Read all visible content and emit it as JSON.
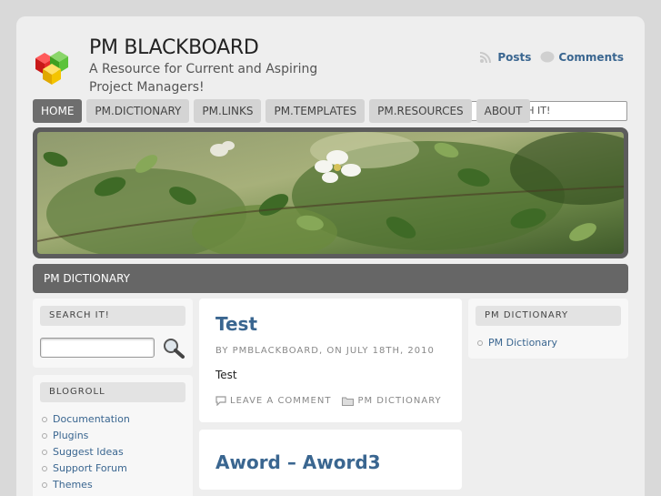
{
  "site": {
    "title": "PM BLACKBOARD",
    "description": "A Resource for Current and Aspiring Project Managers!"
  },
  "feeds": {
    "posts_label": "Posts",
    "comments_label": "Comments"
  },
  "nav": {
    "items": [
      {
        "label": "HOME"
      },
      {
        "label": "PM.DICTIONARY"
      },
      {
        "label": "PM.LINKS"
      },
      {
        "label": "PM.TEMPLATES"
      },
      {
        "label": "PM.RESOURCES"
      },
      {
        "label": "ABOUT"
      }
    ],
    "search_value": "SEARCH IT!"
  },
  "breadcrumb": {
    "label": "PM DICTIONARY"
  },
  "sidebar_left": {
    "search_title": "SEARCH IT!",
    "blogroll_title": "BLOGROLL",
    "blogroll": [
      "Documentation",
      "Plugins",
      "Suggest Ideas",
      "Support Forum",
      "Themes"
    ]
  },
  "posts": [
    {
      "title": "Test",
      "meta": "BY PMBLACKBOARD, ON JULY 18TH, 2010",
      "body": "Test",
      "comment_label": "LEAVE A COMMENT",
      "category_label": "PM DICTIONARY"
    },
    {
      "title": "Aword – Aword3"
    }
  ],
  "sidebar_right": {
    "title": "PM DICTIONARY",
    "items": [
      "PM Dictionary"
    ]
  },
  "colors": {
    "link": "#3a6690",
    "nav_active": "#6e6e6e",
    "bar": "#666666"
  }
}
